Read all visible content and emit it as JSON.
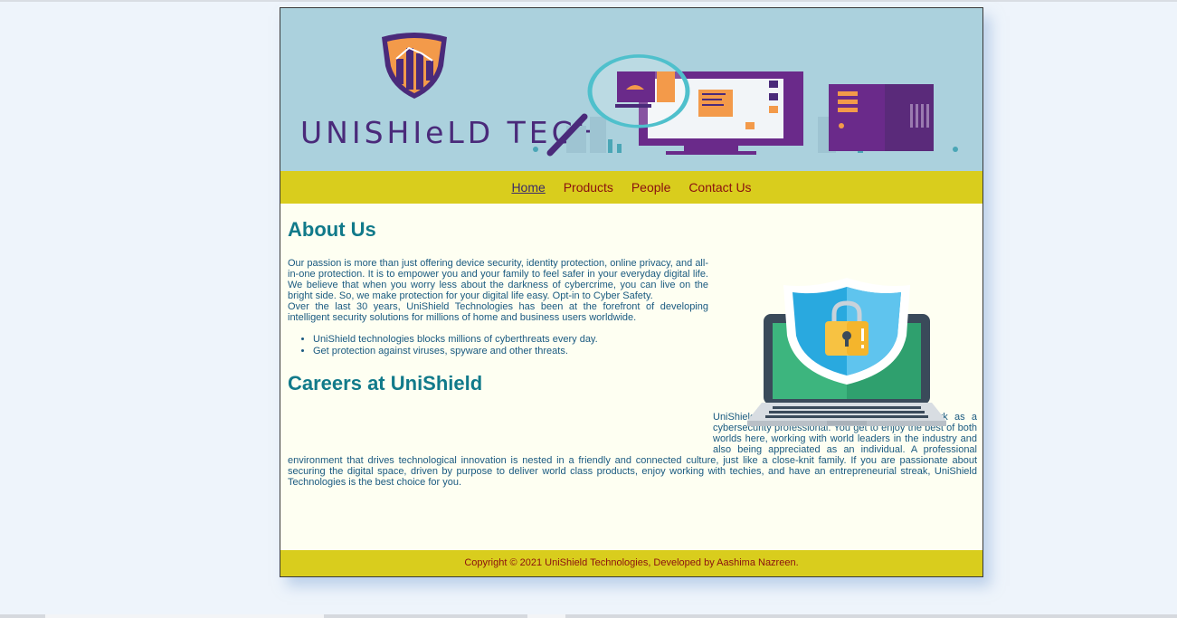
{
  "brand": {
    "name": "UNISHIeLD TECH"
  },
  "nav": {
    "items": [
      "Home",
      "Products",
      "People",
      "Contact Us"
    ]
  },
  "about": {
    "heading": "About Us",
    "p1": "Our passion is more than just offering device security, identity protection, online privacy, and all-in-one protection. It is to empower you and your family to feel safer in your everyday digital life. We believe that when you worry less about the darkness of cybercrime, you can live on the bright side. So, we make protection for your digital life easy. Opt-in to Cyber Safety.",
    "p2": "Over the last 30 years, UniShield Technologies has been at the forefront of developing intelligent security solutions for millions of home and business users worldwide.",
    "bullets": [
      "UniShield technologies blocks millions of cyberthreats every day.",
      "Get protection against viruses, spyware and other threats."
    ]
  },
  "careers": {
    "heading": "Careers at UniShield",
    "p": "UniShield Technologies is a great place to work as a cybersecurity professional. You get to enjoy the best of both worlds here, working with world leaders in the industry and also being appreciated as an individual. A professional environment that drives technological innovation is nested in a friendly and connected culture, just like a close-knit family. If you are passionate about securing the digital space, driven by purpose to deliver world class products, enjoy working with techies, and have an entrepreneurial streak, UniShield Technologies is the best choice for you."
  },
  "footer": {
    "text": "Copyright © 2021 UniShield Technologies, Developed by Aashima Nazreen."
  },
  "colors": {
    "banner": "#abd1dd",
    "nav": "#d9cd1d",
    "content_bg": "#fefff2",
    "heading": "#117a8a",
    "nav_link": "#8a1010",
    "brand_text": "#4a2a7a"
  },
  "icons": [
    "shield-logo-icon",
    "magnifier-icon",
    "monitor-icon",
    "tower-icon",
    "laptop-shield-lock-icon"
  ]
}
